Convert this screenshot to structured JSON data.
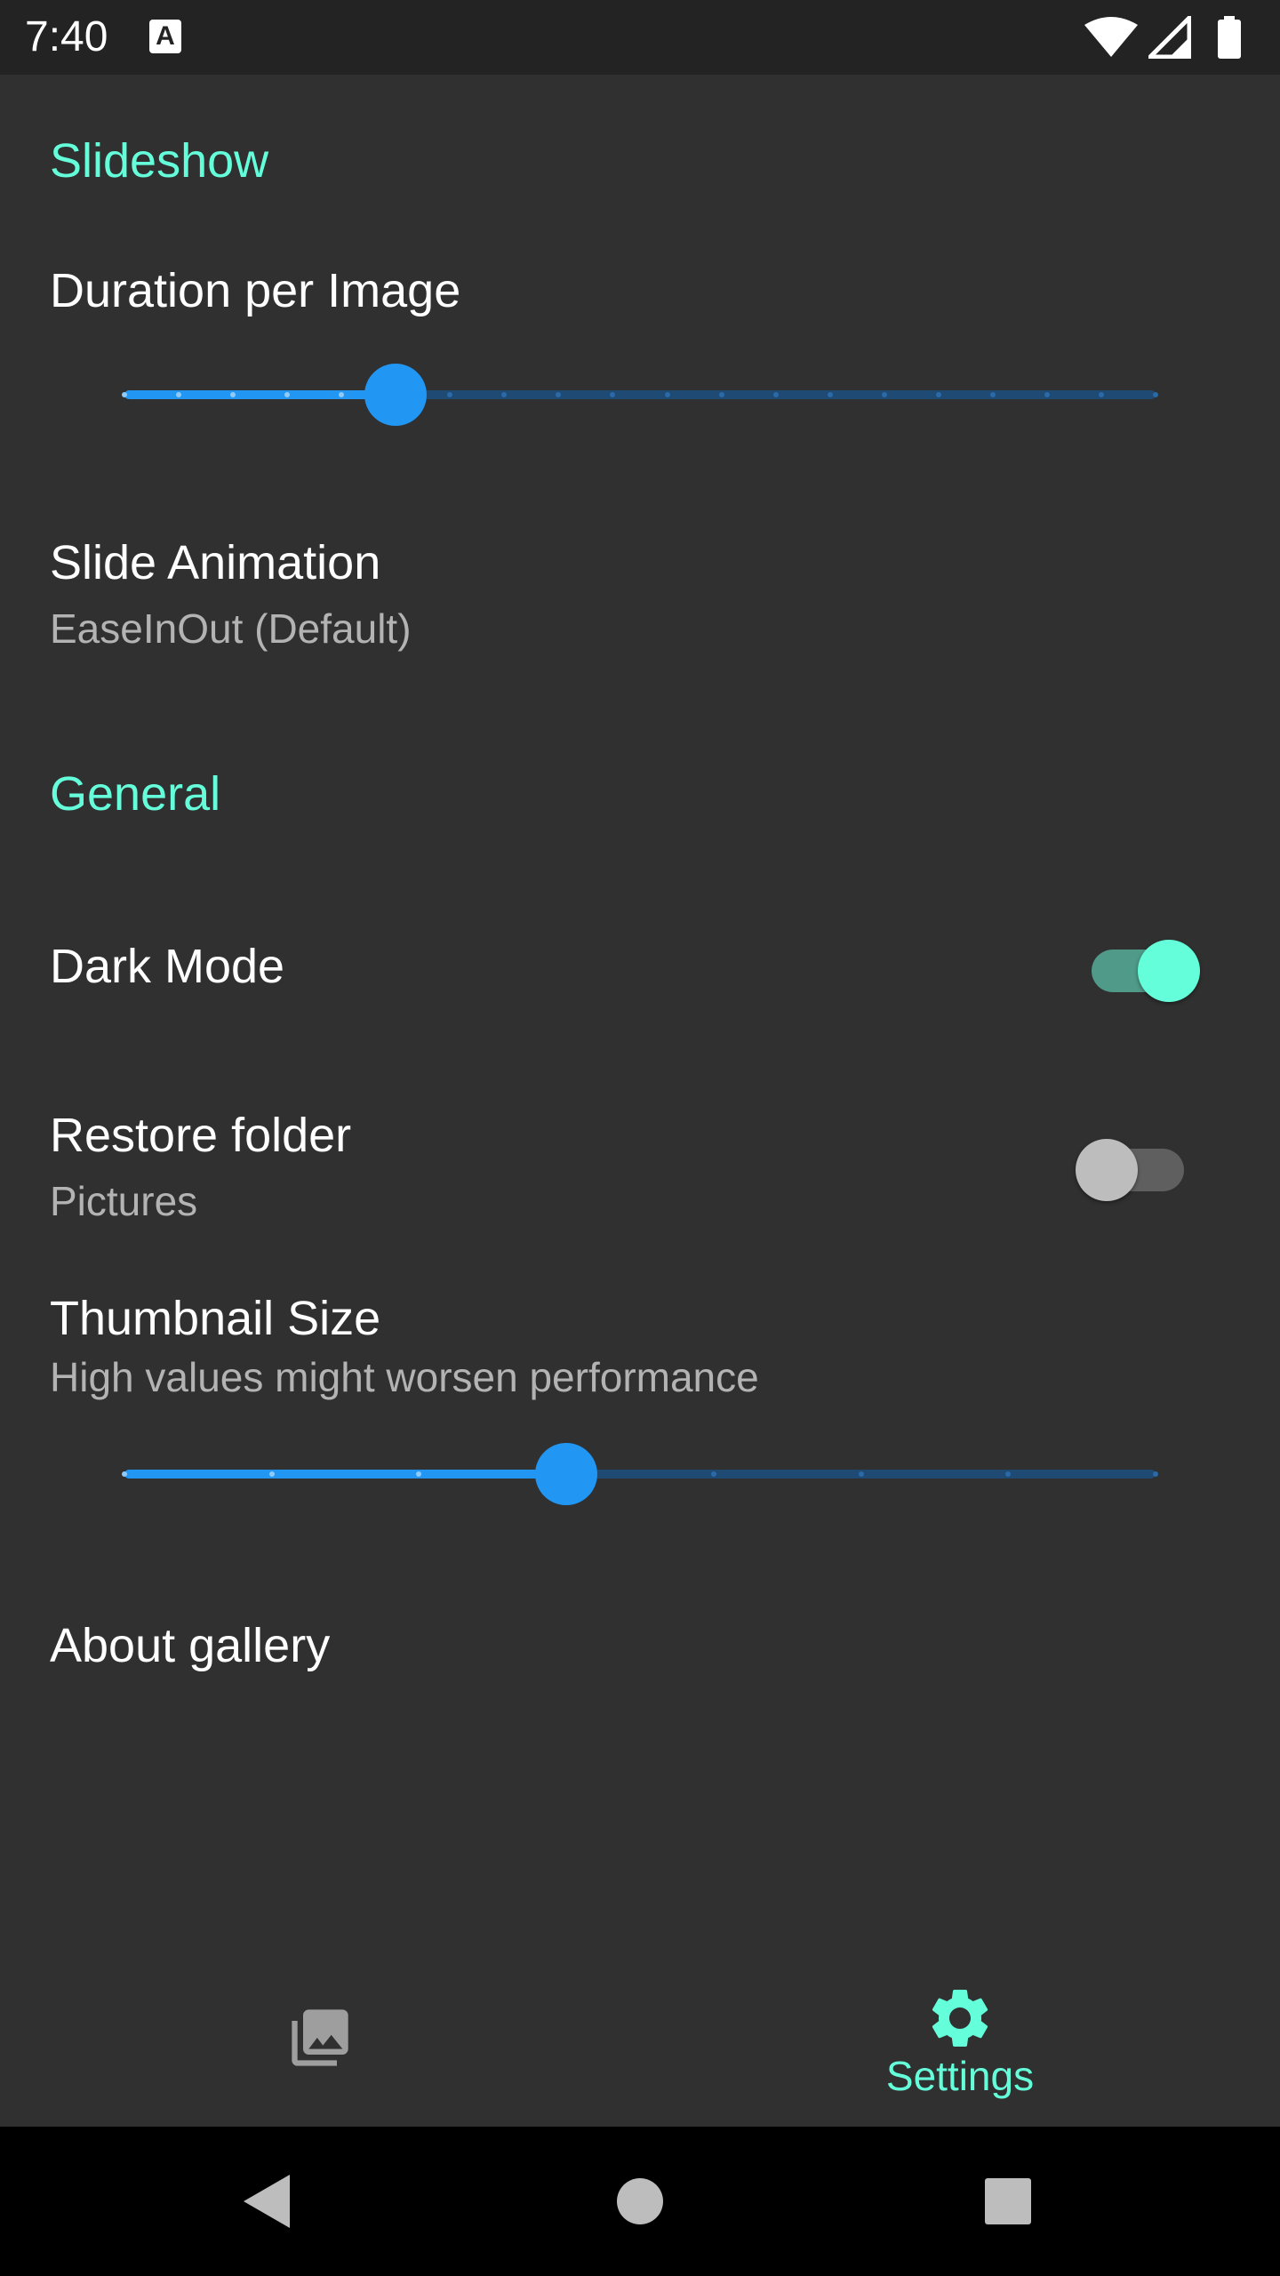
{
  "status_bar": {
    "time": "7:40",
    "notification_icon": "a-icon",
    "icons": [
      "wifi-icon",
      "signal-icon",
      "battery-icon"
    ]
  },
  "slideshow": {
    "header": "Slideshow",
    "duration": {
      "title": "Duration per Image",
      "value": 6,
      "min": 1,
      "max": 20
    },
    "animation": {
      "title": "Slide Animation",
      "summary": "EaseInOut (Default)"
    }
  },
  "general": {
    "header": "General",
    "dark_mode": {
      "title": "Dark Mode",
      "enabled": true
    },
    "restore_folder": {
      "title": "Restore folder",
      "summary": "Pictures",
      "enabled": false
    },
    "thumbnail_size": {
      "title": "Thumbnail Size",
      "summary": "High values might worsen performance",
      "value": 4,
      "min": 1,
      "max": 8
    },
    "about": {
      "title": "About gallery"
    }
  },
  "bottom_nav": {
    "items": [
      {
        "icon": "photo-library-icon",
        "label": ""
      },
      {
        "icon": "gear-icon",
        "label": "Settings",
        "selected": true
      }
    ]
  },
  "colors": {
    "accent": "#64FFDA",
    "primary": "#2196F3",
    "background": "#303030"
  }
}
